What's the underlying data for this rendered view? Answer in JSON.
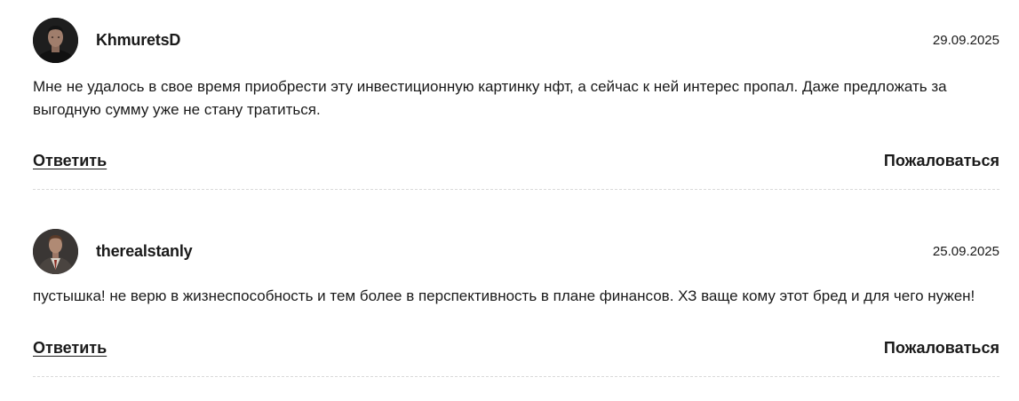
{
  "comments": [
    {
      "username": "KhmuretsD",
      "date": "29.09.2025",
      "text": "Мне не удалось в свое время приобрести эту инвестиционную картинку нфт, а сейчас к ней интерес пропал. Даже предложать за выгодную сумму уже не стану тратиться.",
      "reply_label": "Ответить",
      "report_label": "Пожаловаться",
      "avatar_icon": "user-avatar-photo"
    },
    {
      "username": "therealstanly",
      "date": "25.09.2025",
      "text": "пустышка! не верю в жизнеспособность и тем более в перспективность в плане финансов. ХЗ ваще кому этот бред и для чего нужен!",
      "reply_label": "Ответить",
      "report_label": "Пожаловаться",
      "avatar_icon": "user-avatar-photo"
    }
  ]
}
